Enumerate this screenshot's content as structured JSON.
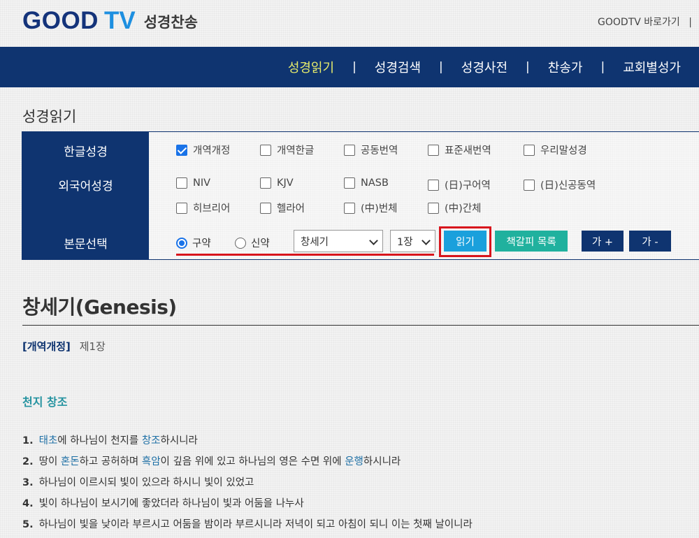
{
  "header": {
    "logo_good": "GOOD",
    "logo_tv": "TV",
    "logo_sub": "성경찬송",
    "top_link": "GOODTV 바로가기",
    "top_sep": "|"
  },
  "nav": {
    "items": [
      "성경읽기",
      "성경검색",
      "성경사전",
      "찬송가",
      "교회별성가"
    ],
    "separator": "|",
    "active": "성경읽기"
  },
  "page_title": "성경읽기",
  "panel": {
    "korean_label": "한글성경",
    "korean_versions": [
      {
        "label": "개역개정",
        "checked": true
      },
      {
        "label": "개역한글",
        "checked": false
      },
      {
        "label": "공동번역",
        "checked": false
      },
      {
        "label": "표준새번역",
        "checked": false
      },
      {
        "label": "우리말성경",
        "checked": false
      }
    ],
    "foreign_label": "외국어성경",
    "foreign_versions": [
      {
        "label": "NIV",
        "checked": false
      },
      {
        "label": "KJV",
        "checked": false
      },
      {
        "label": "NASB",
        "checked": false
      },
      {
        "label": "(日)구어역",
        "checked": false
      },
      {
        "label": "(日)신공동역",
        "checked": false
      },
      {
        "label": "히브리어",
        "checked": false
      },
      {
        "label": "헬라어",
        "checked": false
      },
      {
        "label": "(中)번체",
        "checked": false
      },
      {
        "label": "(中)간체",
        "checked": false
      }
    ],
    "text_label": "본문선택",
    "testament": [
      {
        "label": "구약",
        "selected": true
      },
      {
        "label": "신약",
        "selected": false
      }
    ],
    "book_select": "창세기",
    "chapter_select": "1장",
    "read_button": "읽기",
    "bookmark_button": "책갈피 목록",
    "font_up_button": "가 +",
    "font_down_button": "가 -"
  },
  "content": {
    "book_title": "창세기(Genesis)",
    "version_tag": "[개역개정]",
    "chapter": "제1장",
    "section_title": "천지 창조",
    "verses": [
      {
        "num": "1.",
        "parts": [
          {
            "t": "태초",
            "k": true
          },
          {
            "t": "에 하나님이 천지를 "
          },
          {
            "t": "창조",
            "k": true
          },
          {
            "t": "하시니라"
          }
        ]
      },
      {
        "num": "2.",
        "parts": [
          {
            "t": "땅이 "
          },
          {
            "t": "혼돈",
            "k": true
          },
          {
            "t": "하고 공허하며 "
          },
          {
            "t": "흑암",
            "k": true
          },
          {
            "t": "이 깊음 위에 있고 하나님의 영은 수면 위에 "
          },
          {
            "t": "운행",
            "k": true
          },
          {
            "t": "하시니라"
          }
        ]
      },
      {
        "num": "3.",
        "parts": [
          {
            "t": "하나님이 이르시되 빛이 있으라 하시니 빛이 있었고"
          }
        ]
      },
      {
        "num": "4.",
        "parts": [
          {
            "t": "빛이 하나님이 보시기에 좋았더라 하나님이 빛과 어둠을 나누사"
          }
        ]
      },
      {
        "num": "5.",
        "parts": [
          {
            "t": "하나님이 빛을 낮이라 부르시고 어둠을 밤이라 부르시니라 저녁이 되고 아침이 되니 이는 첫째 날이니라"
          }
        ]
      }
    ]
  },
  "colors": {
    "navy": "#0f3470",
    "active_nav": "#e7ec6b",
    "read_button": "#1aa0dc",
    "bookmark_button": "#20b19e",
    "highlight_red": "#d8141c",
    "keyword": "#1d6fa5",
    "section": "#2593a0"
  }
}
